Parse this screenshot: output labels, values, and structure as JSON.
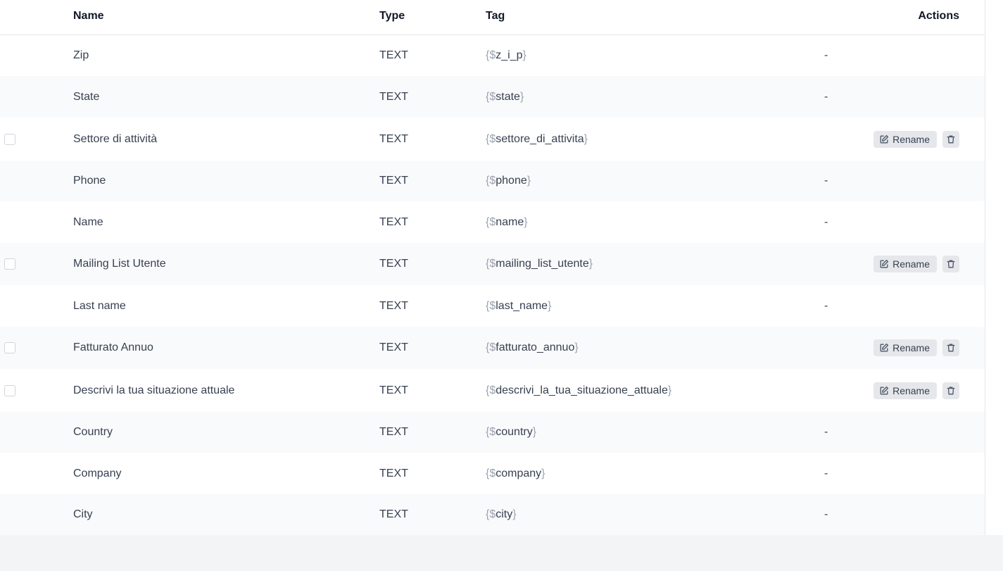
{
  "table": {
    "headers": {
      "name": "Name",
      "type": "Type",
      "tag": "Tag",
      "actions": "Actions"
    },
    "rename_label": "Rename",
    "rows": [
      {
        "name": "Zip",
        "type": "TEXT",
        "tag_open": "{$",
        "tag_key": "z_i_p",
        "tag_close": "}",
        "action": "-",
        "editable": false
      },
      {
        "name": "State",
        "type": "TEXT",
        "tag_open": "{$",
        "tag_key": "state",
        "tag_close": "}",
        "action": "-",
        "editable": false
      },
      {
        "name": "Settore di attività",
        "type": "TEXT",
        "tag_open": "{$",
        "tag_key": "settore_di_attivita",
        "tag_close": "}",
        "action": "",
        "editable": true
      },
      {
        "name": "Phone",
        "type": "TEXT",
        "tag_open": "{$",
        "tag_key": "phone",
        "tag_close": "}",
        "action": "-",
        "editable": false
      },
      {
        "name": "Name",
        "type": "TEXT",
        "tag_open": "{$",
        "tag_key": "name",
        "tag_close": "}",
        "action": "-",
        "editable": false
      },
      {
        "name": "Mailing List Utente",
        "type": "TEXT",
        "tag_open": "{$",
        "tag_key": "mailing_list_utente",
        "tag_close": "}",
        "action": "",
        "editable": true
      },
      {
        "name": "Last name",
        "type": "TEXT",
        "tag_open": "{$",
        "tag_key": "last_name",
        "tag_close": "}",
        "action": "-",
        "editable": false
      },
      {
        "name": "Fatturato Annuo",
        "type": "TEXT",
        "tag_open": "{$",
        "tag_key": "fatturato_annuo",
        "tag_close": "}",
        "action": "",
        "editable": true
      },
      {
        "name": "Descrivi la tua situazione attuale",
        "type": "TEXT",
        "tag_open": "{$",
        "tag_key": "descrivi_la_tua_situazione_attuale",
        "tag_close": "}",
        "action": "",
        "editable": true
      },
      {
        "name": "Country",
        "type": "TEXT",
        "tag_open": "{$",
        "tag_key": "country",
        "tag_close": "}",
        "action": "-",
        "editable": false
      },
      {
        "name": "Company",
        "type": "TEXT",
        "tag_open": "{$",
        "tag_key": "company",
        "tag_close": "}",
        "action": "-",
        "editable": false
      },
      {
        "name": "City",
        "type": "TEXT",
        "tag_open": "{$",
        "tag_key": "city",
        "tag_close": "}",
        "action": "-",
        "editable": false
      }
    ]
  },
  "icons": {
    "rename": "edit-icon",
    "delete": "trash-icon"
  }
}
